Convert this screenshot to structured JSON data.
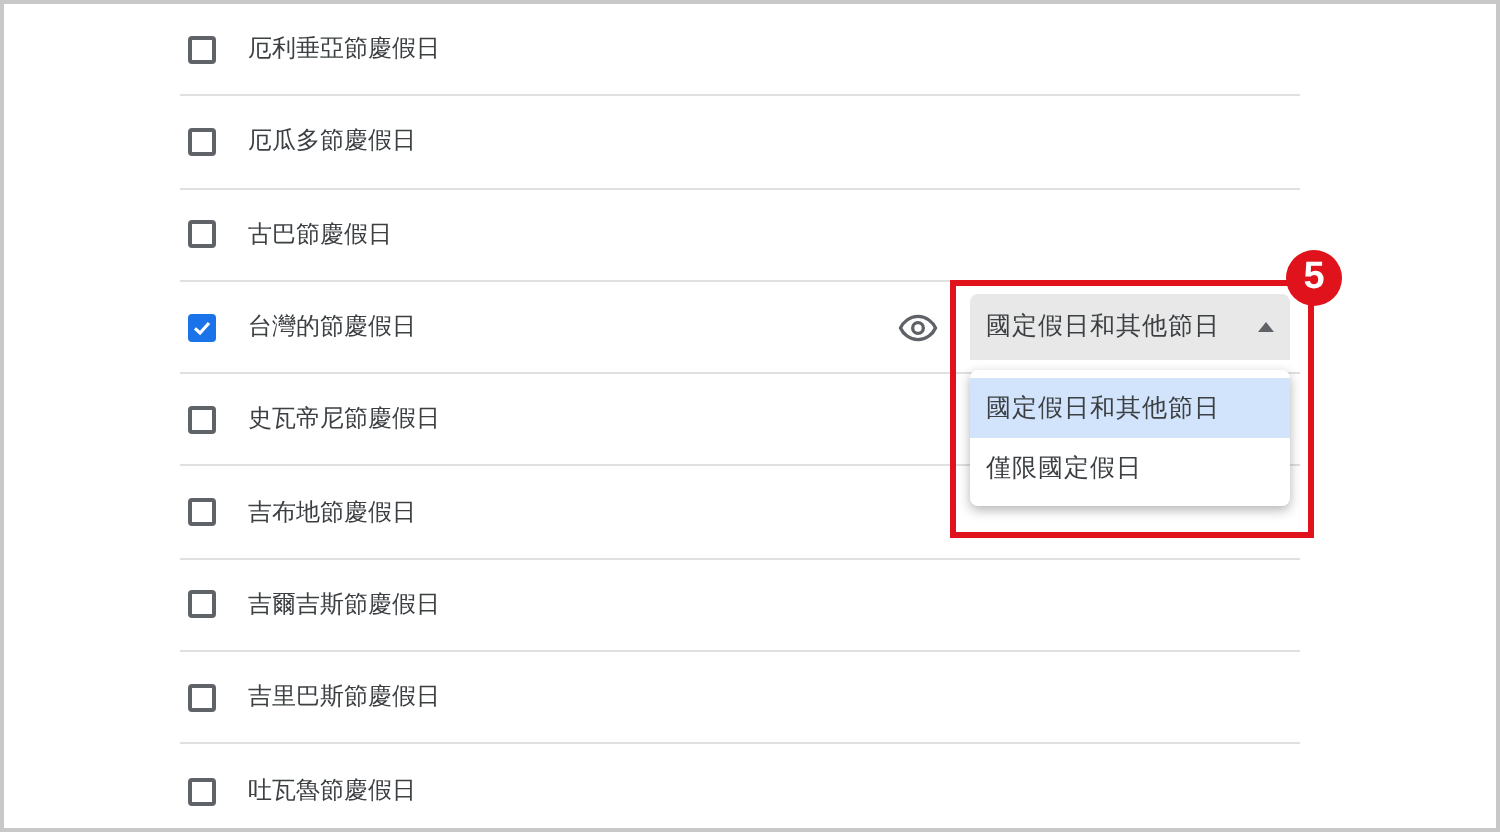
{
  "rows": [
    {
      "label": "厄利垂亞節慶假日",
      "checked": false
    },
    {
      "label": "厄瓜多節慶假日",
      "checked": false
    },
    {
      "label": "古巴節慶假日",
      "checked": false
    },
    {
      "label": "台灣的節慶假日",
      "checked": true,
      "dropdown": {
        "value": "國定假日和其他節日",
        "expanded": true,
        "options": [
          {
            "label": "國定假日和其他節日",
            "selected": true
          },
          {
            "label": "僅限國定假日",
            "selected": false
          }
        ]
      }
    },
    {
      "label": "史瓦帝尼節慶假日",
      "checked": false
    },
    {
      "label": "吉布地節慶假日",
      "checked": false
    },
    {
      "label": "吉爾吉斯節慶假日",
      "checked": false
    },
    {
      "label": "吉里巴斯節慶假日",
      "checked": false
    },
    {
      "label": "吐瓦魯節慶假日",
      "checked": false
    }
  ],
  "annotation": {
    "number": "5"
  }
}
